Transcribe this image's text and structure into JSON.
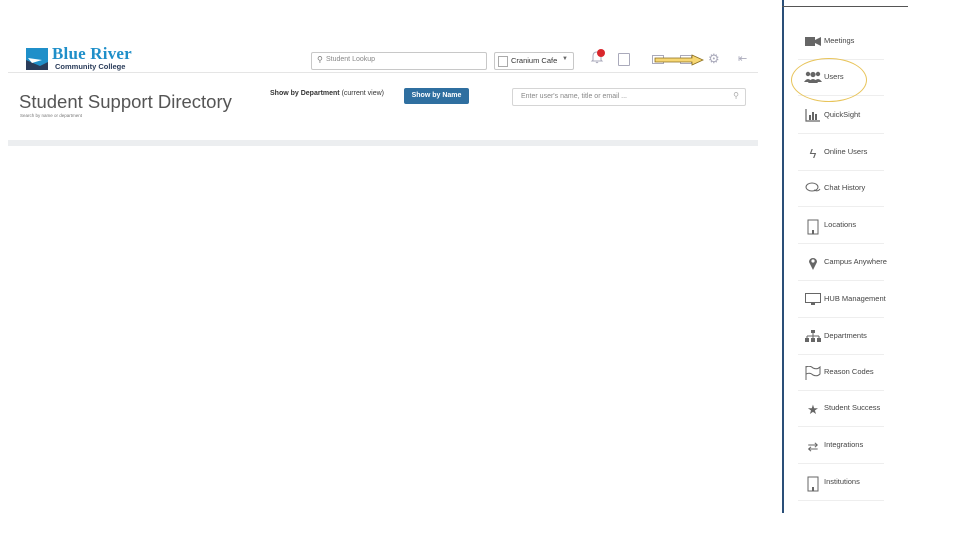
{
  "brand": {
    "name": "Blue River",
    "subtitle": "Community College"
  },
  "header": {
    "student_lookup_placeholder": "Student Lookup",
    "cafe_label": "Cranium Cafe",
    "notification_count": "1"
  },
  "page": {
    "title": "Student Support Directory",
    "subtitle": "Search by name or department",
    "show_by_department": "Show by Department",
    "current_view_note": "(current view)",
    "show_by_name": "Show by Name",
    "user_search_placeholder": "Enter user's name, title or email ..."
  },
  "menu": {
    "items": [
      {
        "label": "Meetings",
        "icon": "video-icon"
      },
      {
        "label": "Users",
        "icon": "users-icon"
      },
      {
        "label": "QuickSight",
        "icon": "bar-chart-icon"
      },
      {
        "label": "Online Users",
        "icon": "bolt-icon"
      },
      {
        "label": "Chat History",
        "icon": "chat-icon"
      },
      {
        "label": "Locations",
        "icon": "building-icon"
      },
      {
        "label": "Campus Anywhere",
        "icon": "map-pin-icon"
      },
      {
        "label": "HUB Management",
        "icon": "monitor-icon"
      },
      {
        "label": "Departments",
        "icon": "sitemap-icon"
      },
      {
        "label": "Reason Codes",
        "icon": "flag-icon"
      },
      {
        "label": "Student Success",
        "icon": "star-icon"
      },
      {
        "label": "Integrations",
        "icon": "exchange-icon"
      },
      {
        "label": "Institutions",
        "icon": "building-icon"
      }
    ]
  },
  "colors": {
    "accent": "#2f6fa0",
    "logo_blue": "#1f8fc9",
    "badge": "#d9262c",
    "arrow": "#f7d774",
    "menu_border": "#2a4f78"
  }
}
